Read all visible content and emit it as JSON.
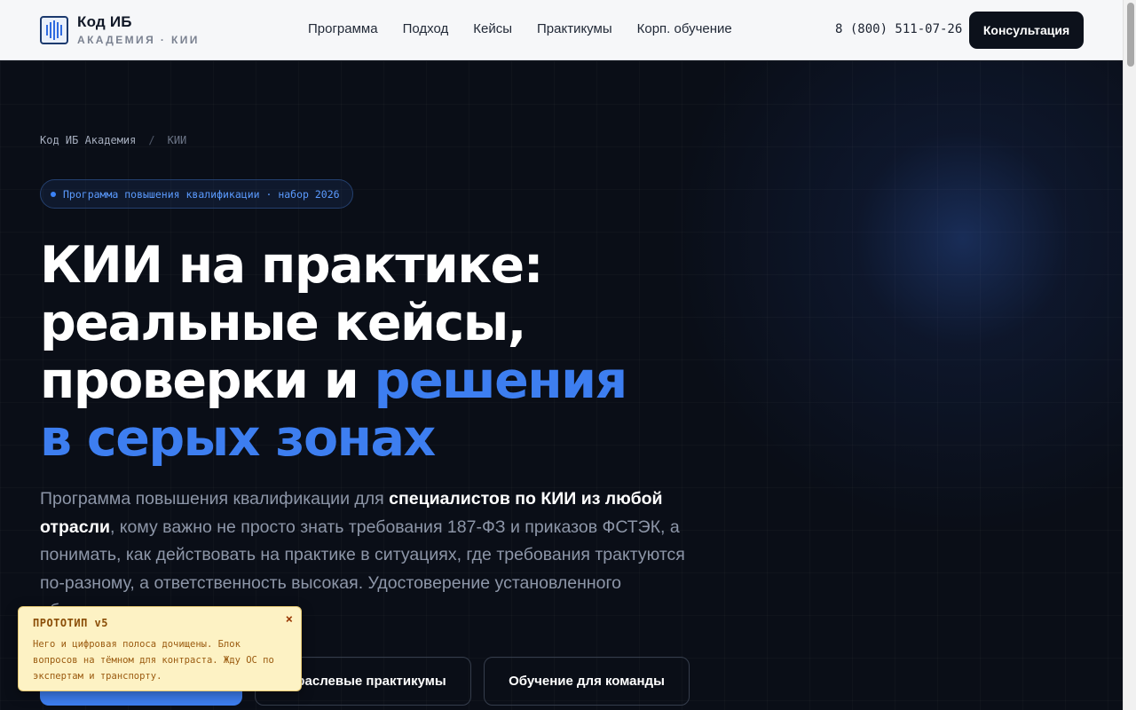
{
  "header": {
    "logo_title": "Код ИБ",
    "logo_subtitle": "АКАДЕМИЯ · КИИ",
    "nav": [
      {
        "label": "Программа"
      },
      {
        "label": "Подход"
      },
      {
        "label": "Кейсы"
      },
      {
        "label": "Практикумы"
      },
      {
        "label": "Корп. обучение"
      }
    ],
    "phone": "8 (800) 511-07-26",
    "cta_label": "Консультация"
  },
  "hero": {
    "breadcrumb": {
      "home": "Код ИБ Академия",
      "separator": "/",
      "current": "КИИ"
    },
    "badge": "Программа повышения квалификации · набор 2026",
    "title_line1": "КИИ на практике:",
    "title_line2": "реальные кейсы,",
    "title_line3_plain": "проверки и ",
    "title_line3_accent": "решения",
    "title_line4_accent": "в серых зонах",
    "lead_part1": "Программа повышения квалификации для ",
    "lead_strong": "специалистов по КИИ из любой отрасли",
    "lead_part2": ", кому важно не просто знать требования 187-ФЗ и приказов ФСТЭК, а понимать, как действовать на практике в ситуациях, где требования трактуются по-разному, а ответственность высокая. Удостоверение установленного образца.",
    "buttons": {
      "industry_label": "Отраслевые практикумы",
      "team_label": "Обучение для команды"
    }
  },
  "prototype_note": {
    "title": "ПРОТОТИП v5",
    "close": "×",
    "body": "Него и цифровая полоса дочищены. Блок вопросов на тёмном для контраста. Жду ОС по экспертам и транспорту."
  },
  "colors": {
    "accent": "#3d7ef0",
    "background": "#0a0e17",
    "header_bg": "#f6f7f9",
    "note_bg": "#fdf2c4"
  }
}
